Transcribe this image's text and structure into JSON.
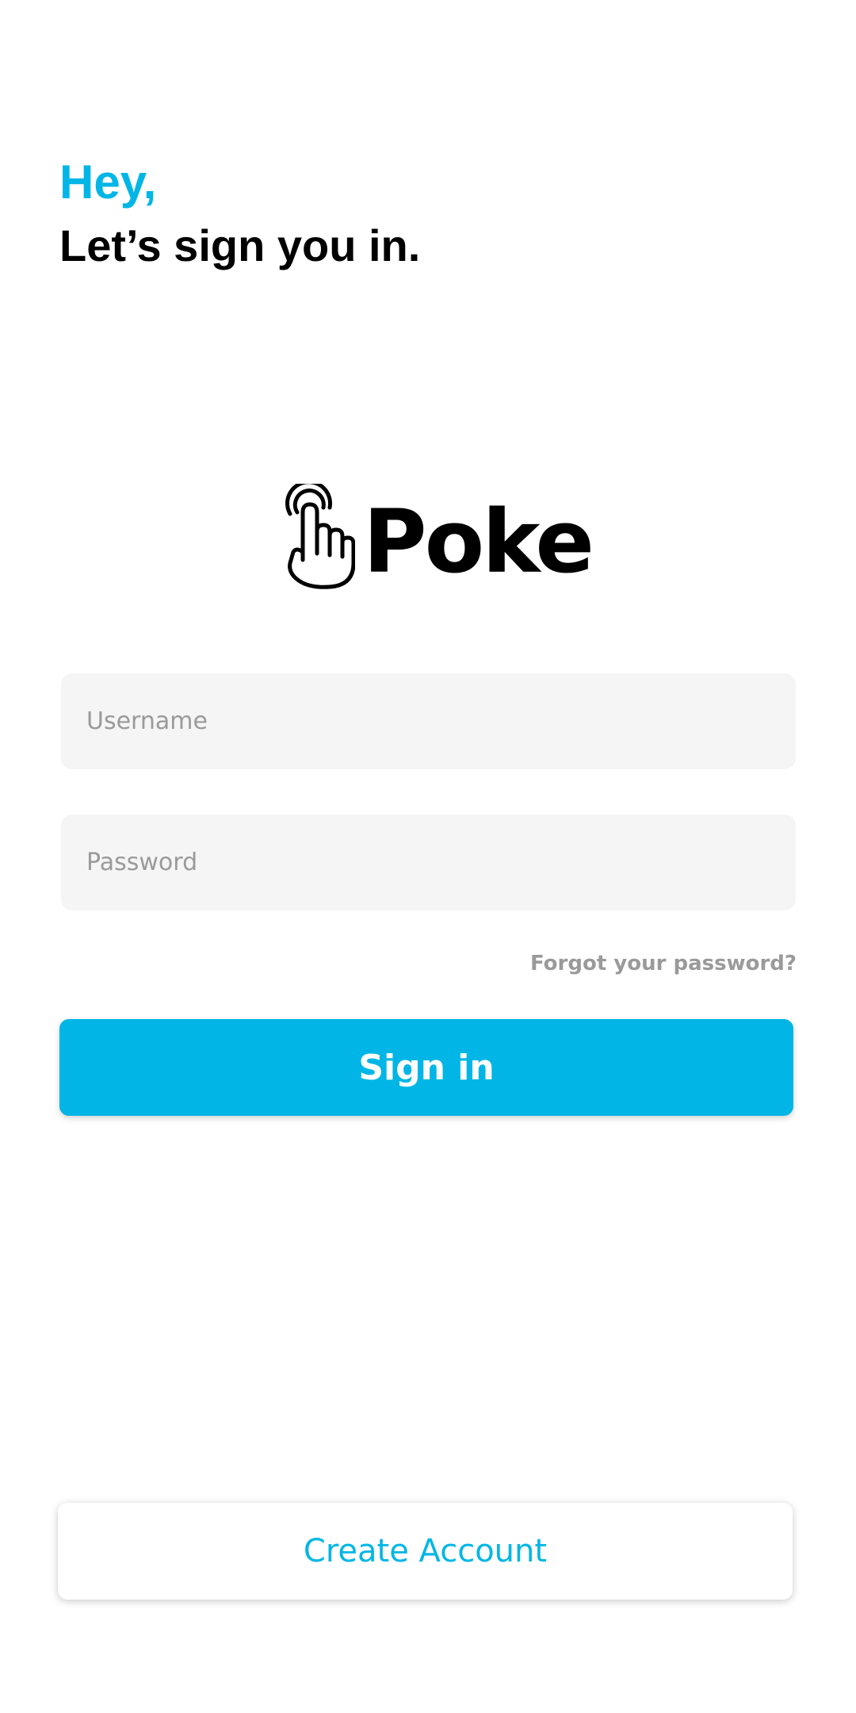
{
  "header": {
    "greeting": "Hey,",
    "subtitle": "Let’s sign you in."
  },
  "logo": {
    "text": "Poke",
    "icon": "tap-hand-icon"
  },
  "form": {
    "username_placeholder": "Username",
    "username_value": "",
    "password_placeholder": "Password",
    "password_value": "",
    "forgot_label": "Forgot your password?",
    "sign_in_label": "Sign in"
  },
  "footer": {
    "create_account_label": "Create Account"
  },
  "colors": {
    "accent": "#01b6e6",
    "field_bg": "#f5f5f5",
    "muted_text": "#9a9a9a"
  }
}
